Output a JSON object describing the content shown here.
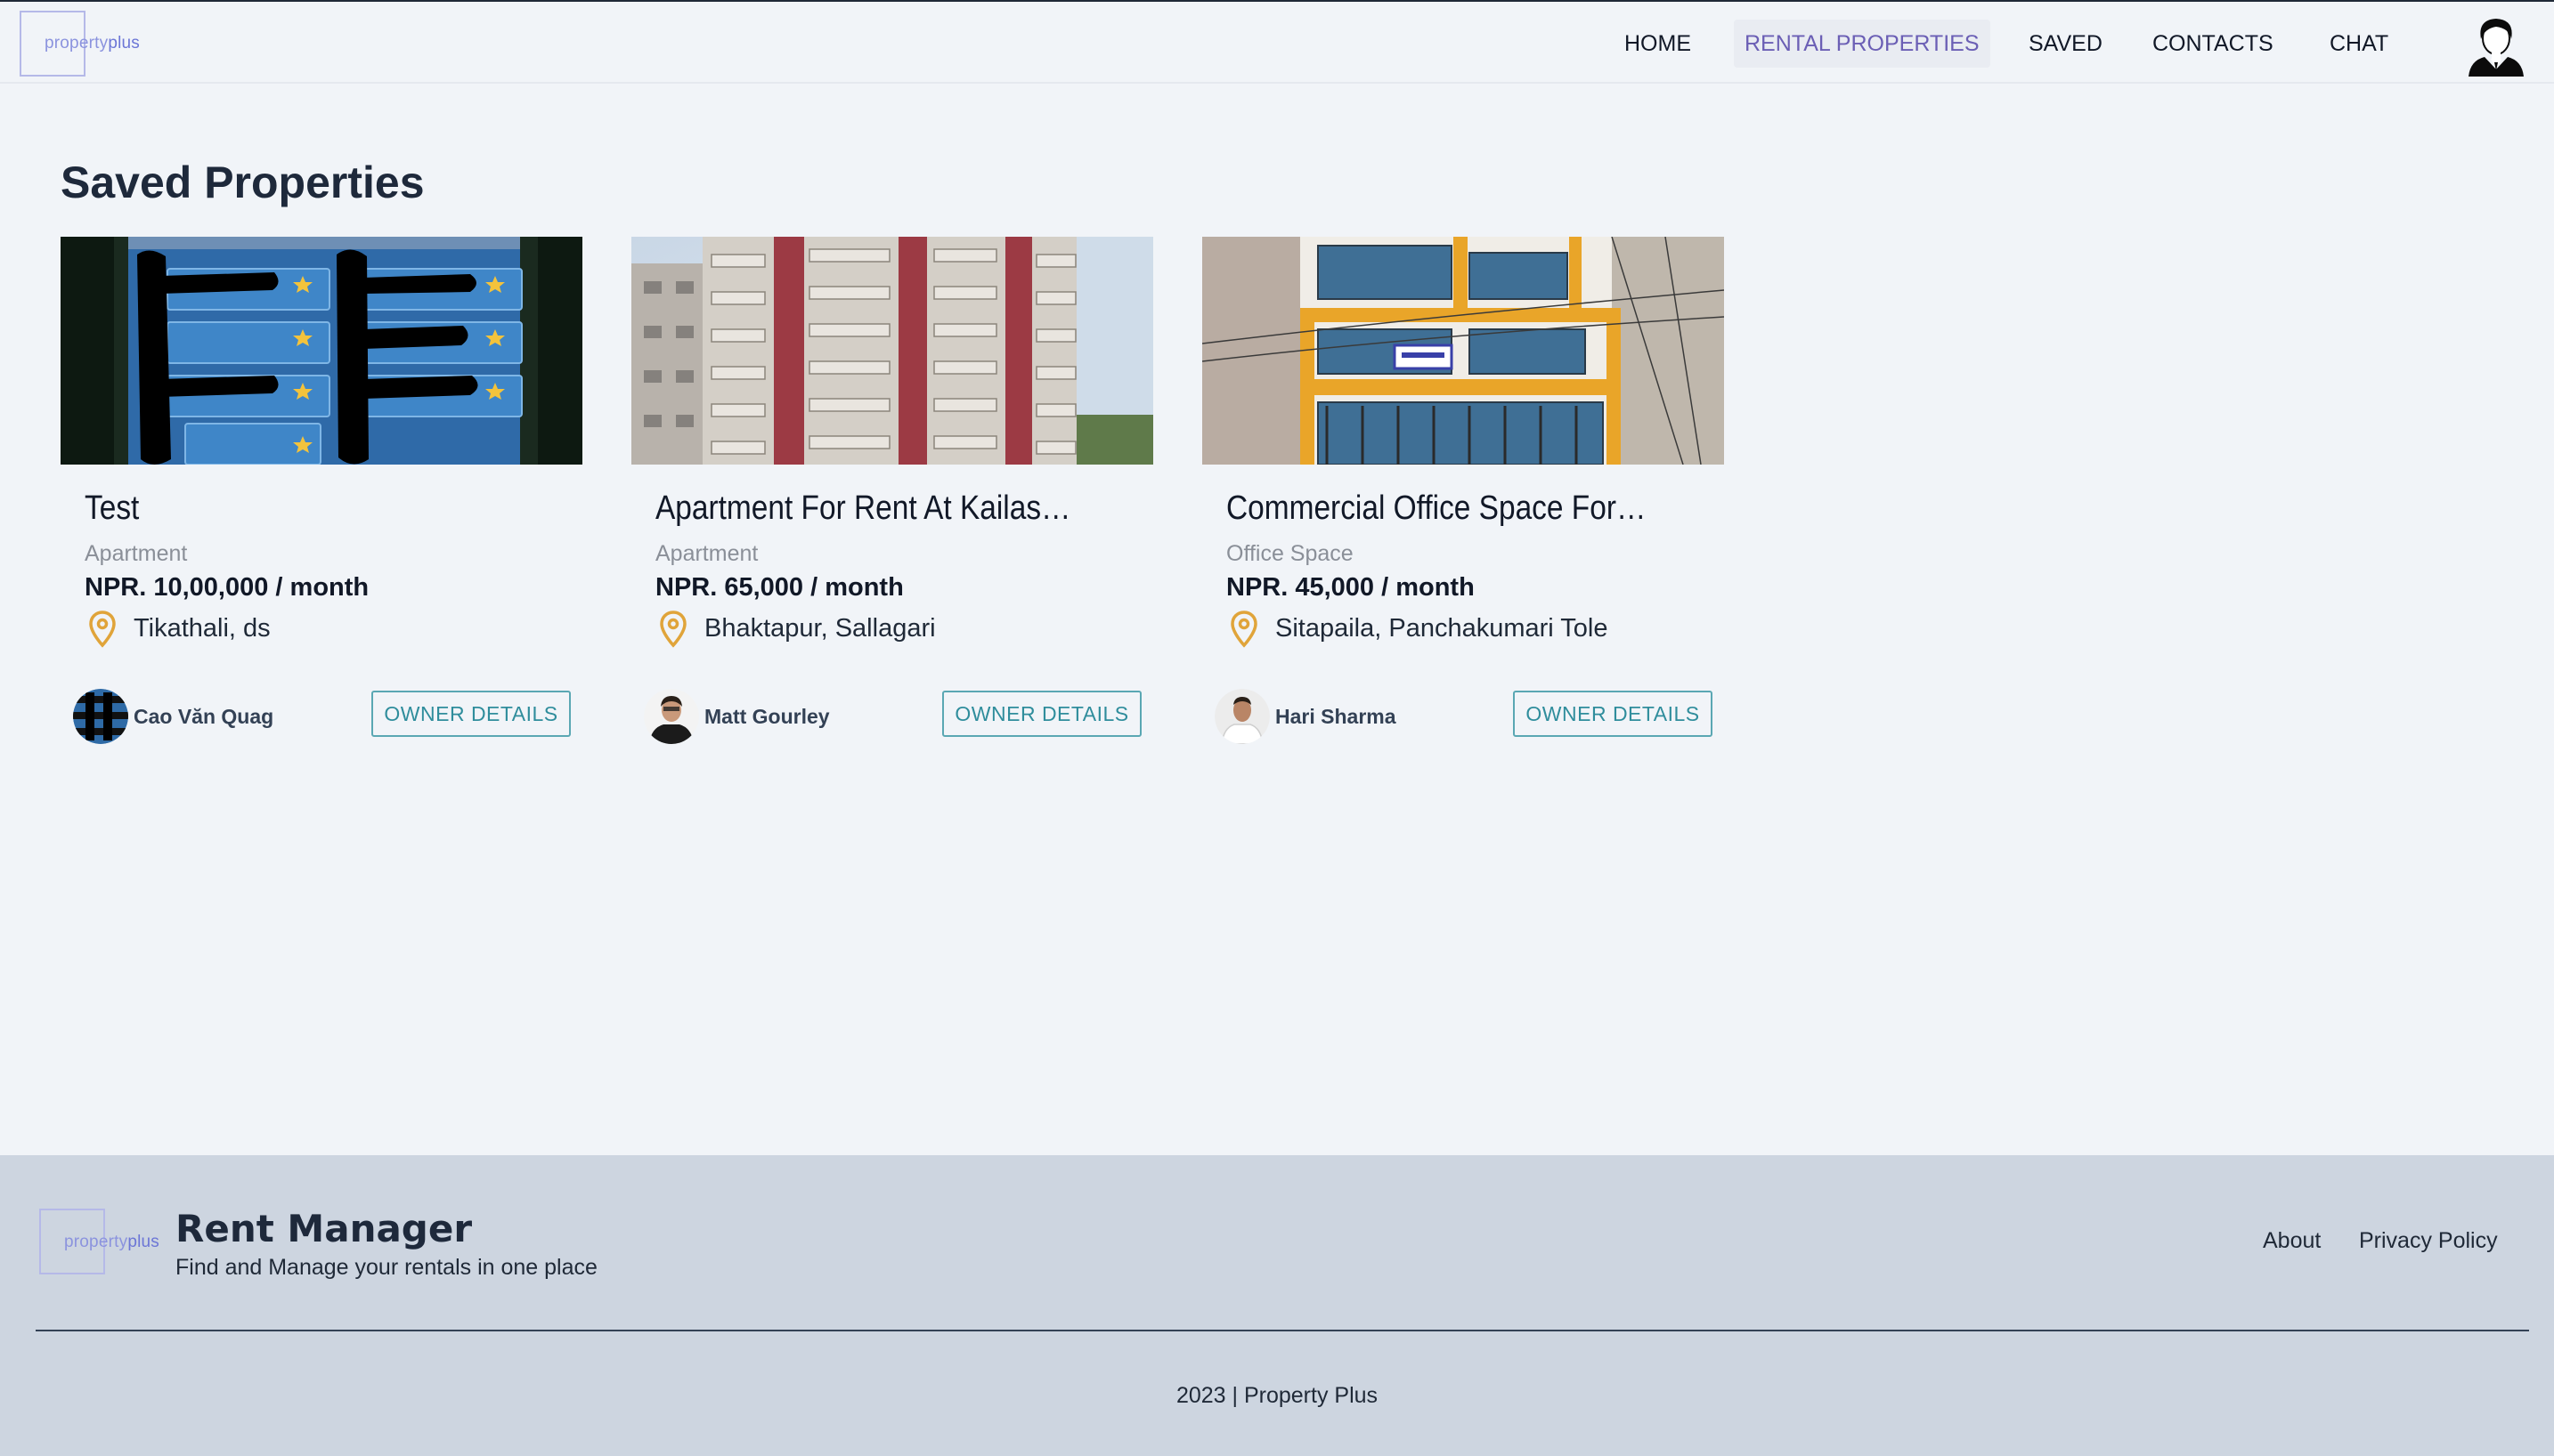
{
  "header": {
    "logo": {
      "text_a": "property",
      "text_b": "plus"
    },
    "nav": [
      {
        "label": "HOME",
        "active": false
      },
      {
        "label": "RENTAL PROPERTIES",
        "active": true
      },
      {
        "label": "SAVED",
        "active": false
      },
      {
        "label": "CONTACTS",
        "active": false
      },
      {
        "label": "CHAT",
        "active": false
      }
    ],
    "user_avatar_icon": "user-avatar-icon"
  },
  "main": {
    "title": "Saved Properties",
    "cards": [
      {
        "title": "Test",
        "type": "Apartment",
        "price": "NPR. 10,00,000 / month",
        "location": "Tikathali, ds",
        "owner": "Cao Văn Quag",
        "button": "OWNER DETAILS"
      },
      {
        "title": "Apartment For Rent At Kailash H...",
        "type": "Apartment",
        "price": "NPR. 65,000 / month",
        "location": "Bhaktapur, Sallagari",
        "owner": "Matt Gourley",
        "button": "OWNER DETAILS"
      },
      {
        "title": "Commercial Office Space For Rent",
        "type": "Office Space",
        "price": "NPR. 45,000 / month",
        "location": "Sitapaila, Panchakumari Tole",
        "owner": "Hari Sharma",
        "button": "OWNER DETAILS"
      }
    ]
  },
  "footer": {
    "logo": {
      "text_a": "property",
      "text_b": "plus"
    },
    "brand": "Rent Manager",
    "tagline": "Find and Manage your rentals in one place",
    "links": [
      "About",
      "Privacy Policy"
    ],
    "copyright": "2023 | Property Plus"
  },
  "colors": {
    "background": "#f1f4f8",
    "footer": "#cdd5e0",
    "accent_nav": "#6b5fb5",
    "button": "#2f8d9c",
    "pin": "#e0a43a"
  }
}
